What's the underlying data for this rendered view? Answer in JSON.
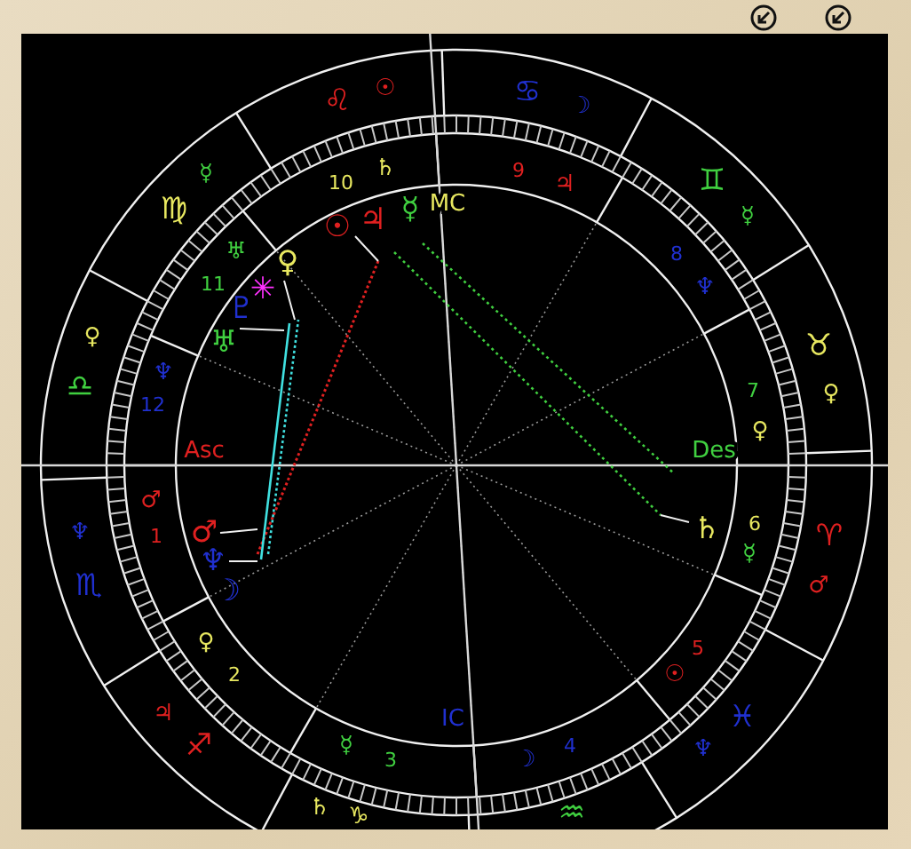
{
  "zodiac_signs": [
    {
      "glyph": "♈",
      "color": "#e02020",
      "ruler": {
        "glyph": "♂",
        "color": "#e02020"
      }
    },
    {
      "glyph": "♉",
      "color": "#e8e860",
      "ruler": {
        "glyph": "♀",
        "color": "#e8e860"
      }
    },
    {
      "glyph": "♊",
      "color": "#40d040",
      "ruler": {
        "glyph": "☿",
        "color": "#40d040"
      }
    },
    {
      "glyph": "♋",
      "color": "#2030d0",
      "ruler": {
        "glyph": "☽",
        "color": "#2030d0"
      }
    },
    {
      "glyph": "♌",
      "color": "#e02020",
      "ruler": {
        "glyph": "☉",
        "color": "#e02020"
      }
    },
    {
      "glyph": "♍",
      "color": "#e8e860",
      "ruler": {
        "glyph": "☿",
        "color": "#40d040"
      }
    },
    {
      "glyph": "♎",
      "color": "#40d040",
      "ruler": {
        "glyph": "♀",
        "color": "#e8e860"
      }
    },
    {
      "glyph": "♏",
      "color": "#2030d0",
      "ruler": {
        "glyph": "♆",
        "color": "#2030d0"
      }
    },
    {
      "glyph": "♐",
      "color": "#e02020",
      "ruler": {
        "glyph": "♃",
        "color": "#e02020"
      }
    },
    {
      "glyph": "♑",
      "color": "#e8e860",
      "ruler": {
        "glyph": "♄",
        "color": "#e8e860"
      }
    },
    {
      "glyph": "♒",
      "color": "#40d040"
    },
    {
      "glyph": "♓",
      "color": "#2030d0",
      "ruler": {
        "glyph": "♆",
        "color": "#2030d0"
      }
    }
  ],
  "houses": [
    {
      "number": "1",
      "color": "#e02020",
      "ruler": {
        "glyph": "♂",
        "color": "#e02020"
      }
    },
    {
      "number": "2",
      "color": "#e8e860",
      "ruler": {
        "glyph": "♀",
        "color": "#e8e860"
      }
    },
    {
      "number": "3",
      "color": "#40d040",
      "ruler": {
        "glyph": "☿",
        "color": "#40d040"
      }
    },
    {
      "number": "4",
      "color": "#2030d0",
      "ruler": {
        "glyph": "☽",
        "color": "#2030d0"
      }
    },
    {
      "number": "5",
      "color": "#e02020",
      "ruler": {
        "glyph": "☉",
        "color": "#e02020"
      }
    },
    {
      "number": "6",
      "color": "#e8e860",
      "ruler": {
        "glyph": "☿",
        "color": "#40d040"
      }
    },
    {
      "number": "7",
      "color": "#40d040",
      "ruler": {
        "glyph": "♀",
        "color": "#e8e860"
      }
    },
    {
      "number": "8",
      "color": "#2030d0",
      "ruler": {
        "glyph": "♆",
        "color": "#2030d0"
      }
    },
    {
      "number": "9",
      "color": "#e02020",
      "ruler": {
        "glyph": "♃",
        "color": "#e02020"
      }
    },
    {
      "number": "10",
      "color": "#e8e860",
      "ruler": {
        "glyph": "♄",
        "color": "#e8e860"
      }
    },
    {
      "number": "11",
      "color": "#40d040",
      "ruler": {
        "glyph": "♅",
        "color": "#40d040"
      }
    },
    {
      "number": "12",
      "color": "#2030d0",
      "ruler": {
        "glyph": "♆",
        "color": "#2030d0"
      }
    }
  ],
  "angles": [
    {
      "label": "Asc",
      "color": "#e02020"
    },
    {
      "label": "MC",
      "color": "#e8e860"
    },
    {
      "label": "Des",
      "color": "#40d040"
    },
    {
      "label": "IC",
      "color": "#2030d0"
    }
  ],
  "planets": [
    {
      "glyph": "☉",
      "color": "#e02020"
    },
    {
      "glyph": "♃",
      "color": "#e02020"
    },
    {
      "glyph": "☿",
      "color": "#40d040"
    },
    {
      "glyph": "♀",
      "color": "#e8e860"
    },
    {
      "glyph": "✳",
      "color": "#ff30ff"
    },
    {
      "glyph": "♇",
      "color": "#2030d0"
    },
    {
      "glyph": "♅",
      "color": "#40d040"
    },
    {
      "glyph": "♂",
      "color": "#e02020"
    },
    {
      "glyph": "♆",
      "color": "#2030d0"
    },
    {
      "glyph": "☽",
      "color": "#2030d0"
    },
    {
      "glyph": "♄",
      "color": "#e8e860"
    }
  ]
}
